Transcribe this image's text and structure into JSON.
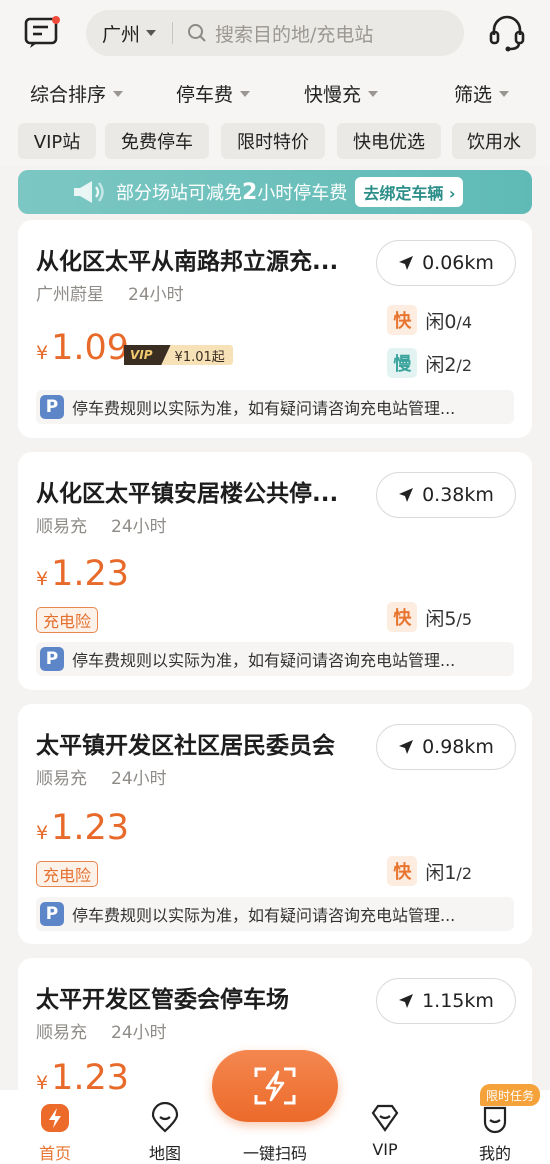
{
  "header": {
    "city": "广州",
    "search_placeholder": "搜索目的地/充电站",
    "message_icon": "message-icon",
    "service_icon": "headset-icon"
  },
  "filters": [
    "综合排序",
    "停车费",
    "快慢充",
    "筛选"
  ],
  "chips": [
    "VIP站",
    "免费停车",
    "限时特价",
    "快电优选",
    "饮用水"
  ],
  "banner": {
    "text_prefix": "部分场站可减免",
    "text_hours": "2",
    "text_suffix": "小时停车费",
    "button": "去绑定车辆 ›"
  },
  "stations": [
    {
      "name": "从化区太平从南路邦立源充...",
      "operator": "广州蔚星",
      "hours": "24小时",
      "distance": "0.06km",
      "price": "1.09",
      "vip_label": "VIP",
      "vip_price": "¥1.01起",
      "fast_label": "快",
      "fast_idle": "闲0",
      "fast_total": "/4",
      "slow_label": "慢",
      "slow_idle": "闲2",
      "slow_total": "/2",
      "note": "停车费规则以实际为准，如有疑问请咨询充电站管理..."
    },
    {
      "name": "从化区太平镇安居楼公共停...",
      "operator": "顺易充",
      "hours": "24小时",
      "distance": "0.38km",
      "price": "1.23",
      "insurance": "充电险",
      "fast_label": "快",
      "fast_idle": "闲5",
      "fast_total": "/5",
      "note": "停车费规则以实际为准，如有疑问请咨询充电站管理..."
    },
    {
      "name": "太平镇开发区社区居民委员会",
      "operator": "顺易充",
      "hours": "24小时",
      "distance": "0.98km",
      "price": "1.23",
      "insurance": "充电险",
      "fast_label": "快",
      "fast_idle": "闲1",
      "fast_total": "/2",
      "note": "停车费规则以实际为准，如有疑问请咨询充电站管理..."
    },
    {
      "name": "太平开发区管委会停车场",
      "operator": "顺易充",
      "hours": "24小时",
      "distance": "1.15km",
      "price": "1.23"
    }
  ],
  "currency": "¥",
  "parking_badge": "P",
  "tabs": [
    "首页",
    "地图",
    "一键扫码",
    "VIP",
    "我的"
  ],
  "promo_badge": "限时任务",
  "colors": {
    "accent": "#e86a2a",
    "teal": "#5fbab6"
  }
}
